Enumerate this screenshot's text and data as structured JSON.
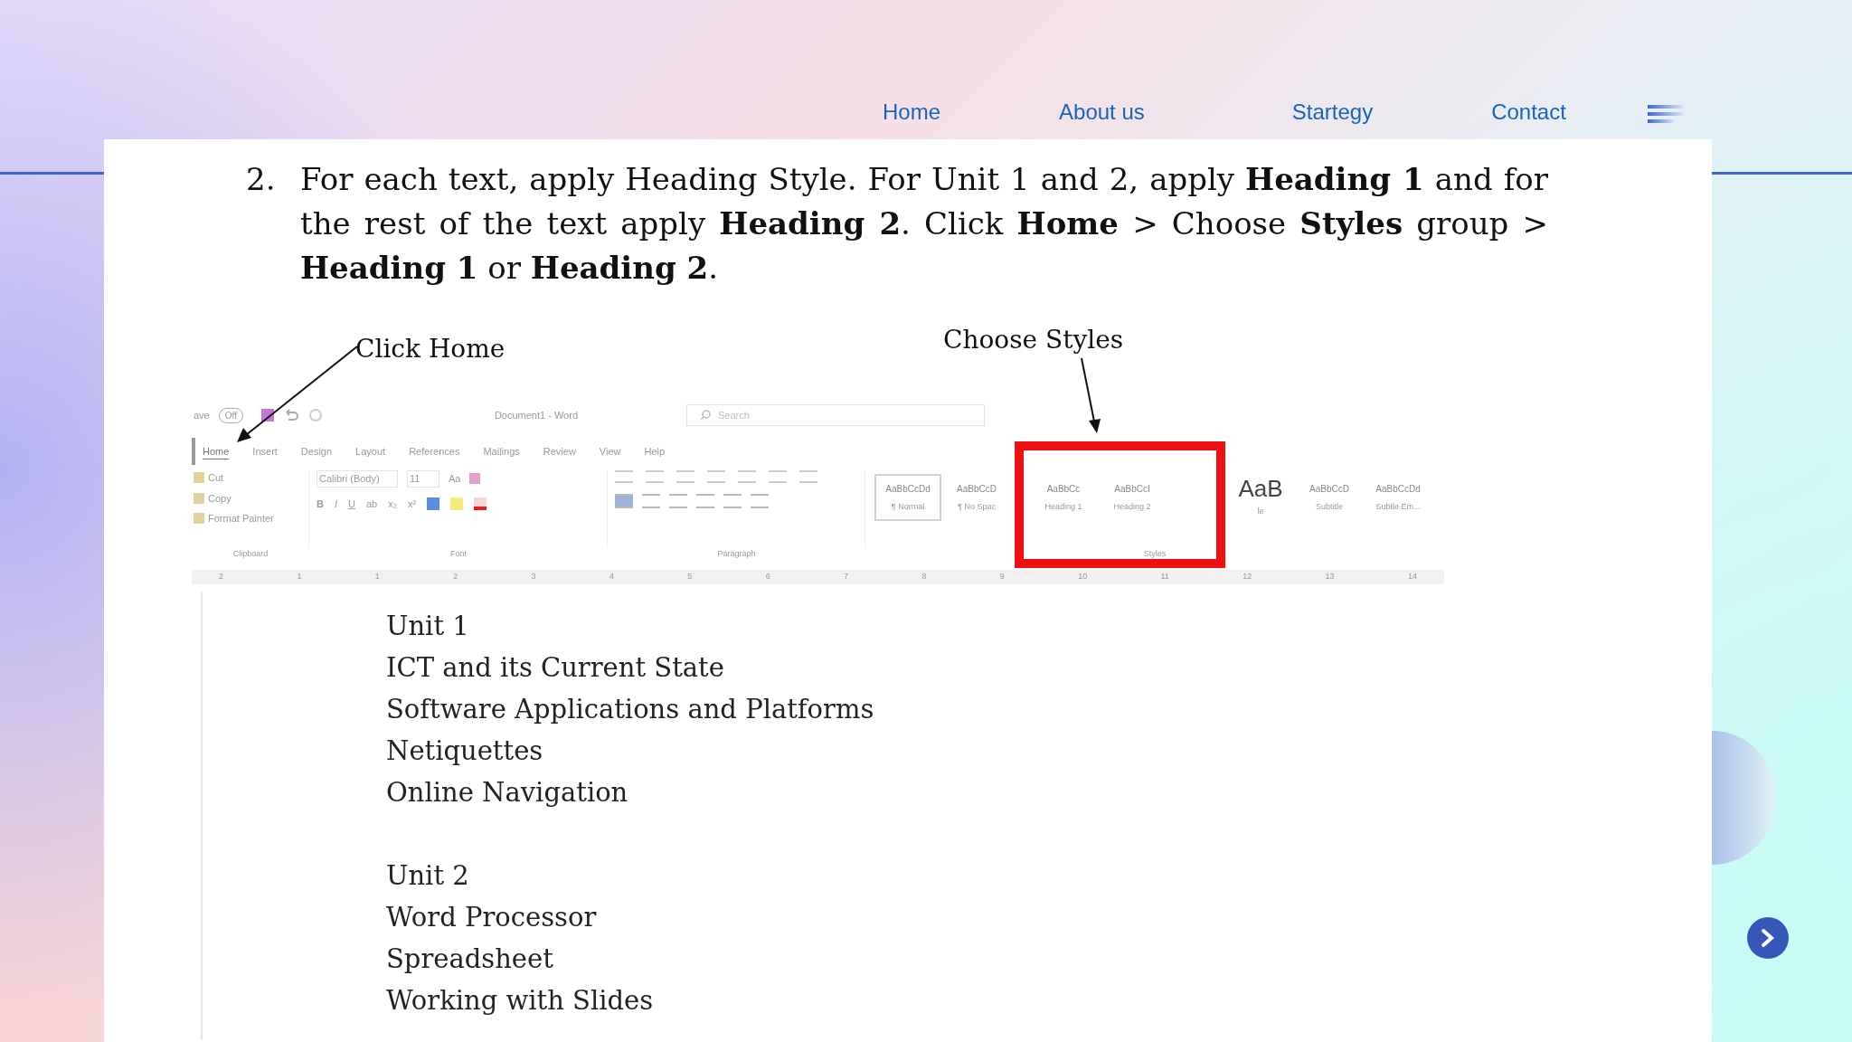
{
  "nav": {
    "links": [
      {
        "label": "Home"
      },
      {
        "label": "About us"
      },
      {
        "label": "Startegy"
      },
      {
        "label": "Contact"
      }
    ]
  },
  "instruction": {
    "number": "2.",
    "text": "For each text, apply Heading Style. For Unit 1 and 2, apply **Heading 1** and for the rest of the text apply **Heading 2**. Click **Home** > Choose **Styles** group > **Heading 1** or **Heading 2**."
  },
  "callouts": [
    {
      "text": "Click Home"
    },
    {
      "text": "Choose Styles"
    }
  ],
  "ribbon": {
    "autosave": "ave",
    "toggle": "Off",
    "title": "Document1 - Word",
    "search": "Search",
    "tabs": [
      {
        "label": "Home",
        "selected": true
      },
      {
        "label": "Insert",
        "selected": false
      },
      {
        "label": "Design",
        "selected": false
      },
      {
        "label": "Layout",
        "selected": false
      },
      {
        "label": "References",
        "selected": false
      },
      {
        "label": "Mailings",
        "selected": false
      },
      {
        "label": "Review",
        "selected": false
      },
      {
        "label": "View",
        "selected": false
      },
      {
        "label": "Help",
        "selected": false
      }
    ],
    "clipboard": [
      "Cut",
      "Copy",
      "Format Painter"
    ],
    "font_name": "Calibri (Body)",
    "font_size": "11",
    "case_button": "Aa",
    "format_buttons": [
      "B",
      "I",
      "U",
      "ab",
      "x₂",
      "x²"
    ],
    "groups": [
      "Clipboard",
      "Font",
      "Paragraph",
      "Styles"
    ],
    "styles": [
      {
        "preview": "AaBbCcDd",
        "name": "¶ Normal",
        "selected": true
      },
      {
        "preview": "AaBbCcD",
        "name": "¶ No Spac",
        "selected": false
      },
      {
        "preview": "AaBbCc",
        "name": "Heading 1",
        "selected": false
      },
      {
        "preview": "AaBbCcI",
        "name": "Heading 2",
        "selected": false
      },
      {
        "preview": "AaB",
        "name": "le",
        "selected": false
      },
      {
        "preview": "AaBbCcD",
        "name": "Subtitle",
        "selected": false
      },
      {
        "preview": "AaBbCcDd",
        "name": "Subtle Em...",
        "selected": false
      }
    ],
    "ruler": [
      "2",
      "1",
      "1",
      "2",
      "3",
      "4",
      "5",
      "6",
      "7",
      "8",
      "9",
      "10",
      "11",
      "12",
      "13",
      "14"
    ]
  },
  "document": [
    {
      "lines": [
        "Unit 1",
        "ICT and its Current State",
        "Software Applications and Platforms",
        "Netiquettes",
        "Online Navigation"
      ]
    },
    {
      "lines": [
        "Unit 2",
        "Word Processor",
        "Spreadsheet",
        "Working with Slides"
      ]
    }
  ]
}
